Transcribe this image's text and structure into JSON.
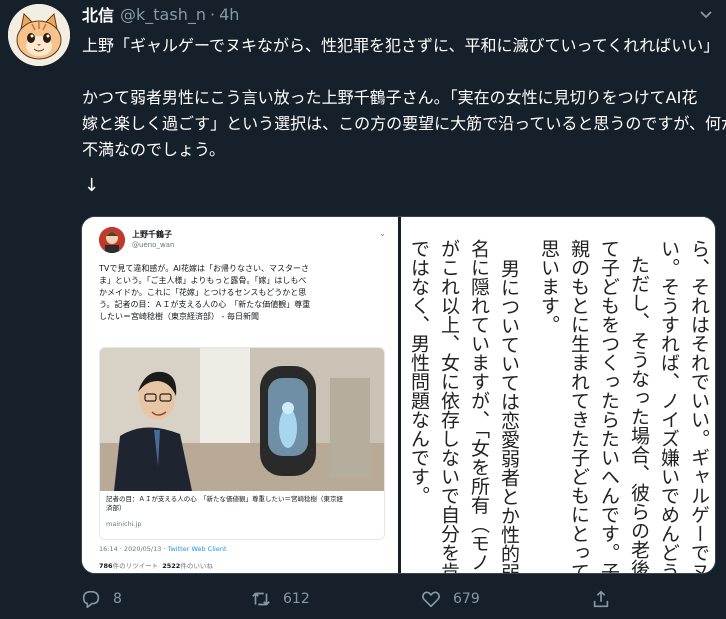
{
  "author": {
    "display_name": "北信",
    "handle": "@k_tash_n",
    "separator": "·",
    "time": "4h"
  },
  "tweet_text": [
    "上野「ギャルゲーでヌキながら、性犯罪を犯さずに、平和に滅びていってくれればいい」",
    "",
    "かつて弱者男性にこう言い放った上野千鶴子さん。「実在の女性に見切りをつけてAI花",
    "嫁と楽しく過ごす」という選択は、この方の要望に大筋で沿っていると思うのですが、何が",
    "不満なのでしょう。",
    "",
    "↓"
  ],
  "embedded_tweet": {
    "name": "上野千鶴子",
    "handle": "@ueno_wan",
    "chevron": "⌄",
    "text": [
      "TVで見て違和感が。AI花嫁は「お帰りなさい、マスターさ",
      "ま」という。「ご主人様」よりもっと露骨。「嫁」はしもべ",
      "かメイドか。これに「花嫁」とつけるセンスもどうかと思",
      "う。記者の目：ＡＩが支える人の心　「新たな価値観」尊重",
      "したい＝宮崎稔樹（東京経済部） - 毎日新聞"
    ],
    "card_title": [
      "記者の目：ＡＩが支える人の心　「新たな価値観」尊重したい＝宮崎稔樹（東京経",
      "済部）"
    ],
    "card_domain": "mainichi.jp",
    "timestamp": "16:14 · 2020/05/13 · ",
    "client": "Twitter Web Client",
    "retweet_count": "786",
    "retweet_label": "件のリツイート",
    "like_count": "2522",
    "like_label": "件のいいね"
  },
  "book_columns": [
    "ら、それはそれでいい。ギャルゲーでヌキ",
    "い。そうすれば、ノイズ嫌いでめんどうく",
    "ただし、そうなった場合、彼らの老後が",
    "て子どもをつくったらたいへんです。子ど",
    "親のもとに生まれてきた子どもにとっては",
    "思います。",
    "男についていては恋愛弱者とか性的弱者とか",
    "名に隠れていますが、「女を所有（モノに）",
    "がこれ以上、女に依存しないで自分を肯定",
    "ではなく、男性問題なんです。"
  ],
  "actions": {
    "reply_count": "8",
    "retweet_count": "612",
    "like_count": "679"
  },
  "icons": [
    "cat-avatar",
    "chevron-down-icon",
    "reply-icon",
    "retweet-icon",
    "like-icon",
    "share-icon"
  ],
  "colors": {
    "background": "#15202b",
    "text": "#ffffff",
    "secondary": "#8899a6",
    "link": "#1b95e0"
  }
}
